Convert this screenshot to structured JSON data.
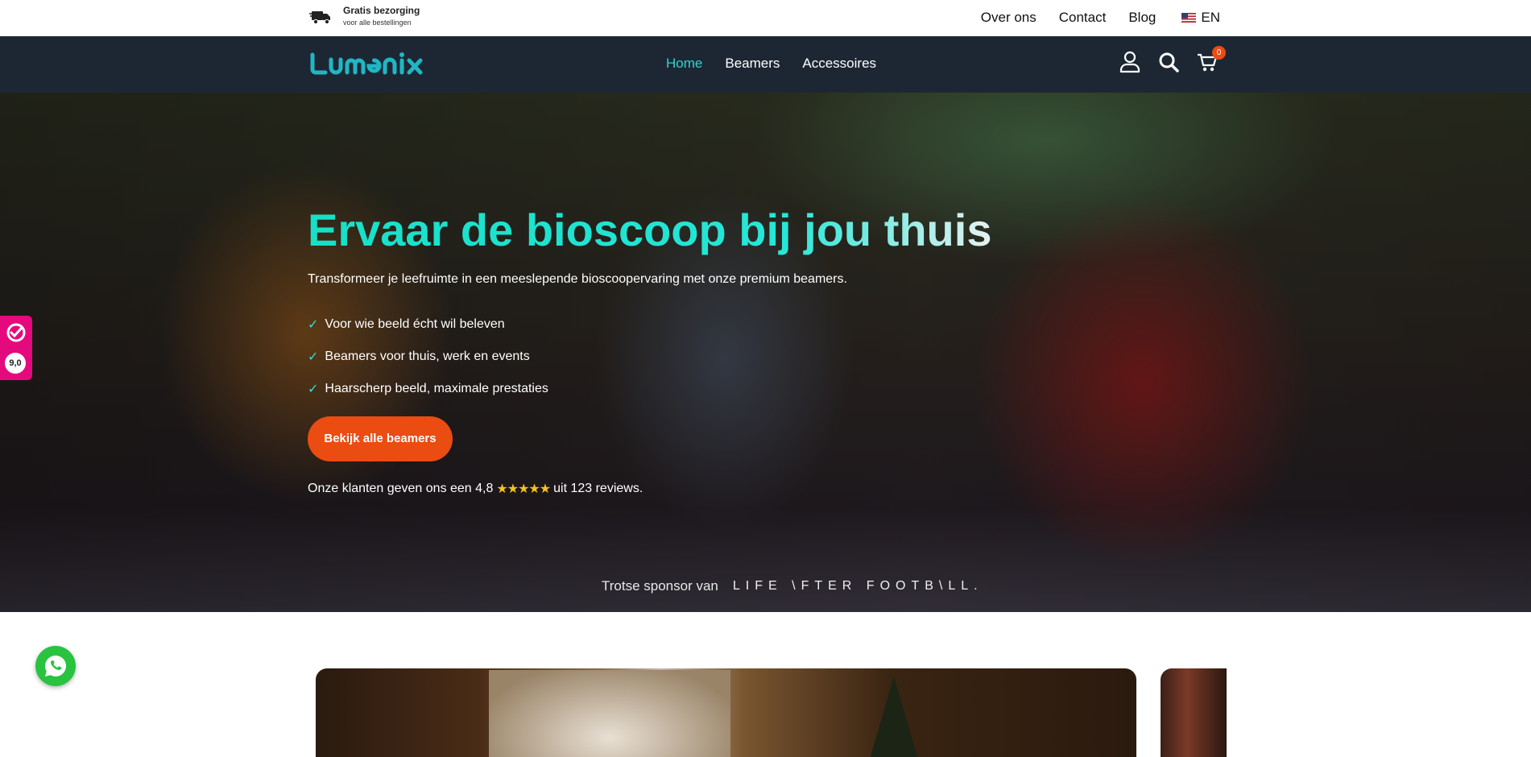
{
  "topbar": {
    "shipping_title": "Gratis bezorging",
    "shipping_sub": "voor alle bestellingen",
    "links": [
      "Over ons",
      "Contact",
      "Blog"
    ],
    "language": "EN"
  },
  "nav": {
    "logo": "Lumenix",
    "menu": [
      "Home",
      "Beamers",
      "Accessoires"
    ],
    "active_item": "Home",
    "cart_count": "0",
    "accent_color": "#2fd2d0",
    "bg_color": "#1d2734"
  },
  "hero": {
    "headline": "Ervaar de bioscoop bij jou thuis",
    "subline": "Transformeer je leefruimte in een meeslepende bioscoopervaring met onze premium beamers.",
    "bullets": [
      "Voor wie beeld écht wil beleven",
      "Beamers voor thuis, werk en events",
      "Haarscherp beeld, maximale prestaties"
    ],
    "cta": "Bekijk alle beamers",
    "reviews_prefix": "Onze klanten geven ons een 4,8",
    "reviews_stars": "★★★★★",
    "reviews_suffix": "uit 123 reviews.",
    "rating_value": 4.8,
    "sponsor_label": "Trotse sponsor van",
    "sponsor_brand": "LIFE \\FTER FOOTB\\LL."
  },
  "side_rating": {
    "score": "9,0",
    "color": "#e5097e"
  },
  "whatsapp": {
    "icon": "whatsapp-icon"
  }
}
